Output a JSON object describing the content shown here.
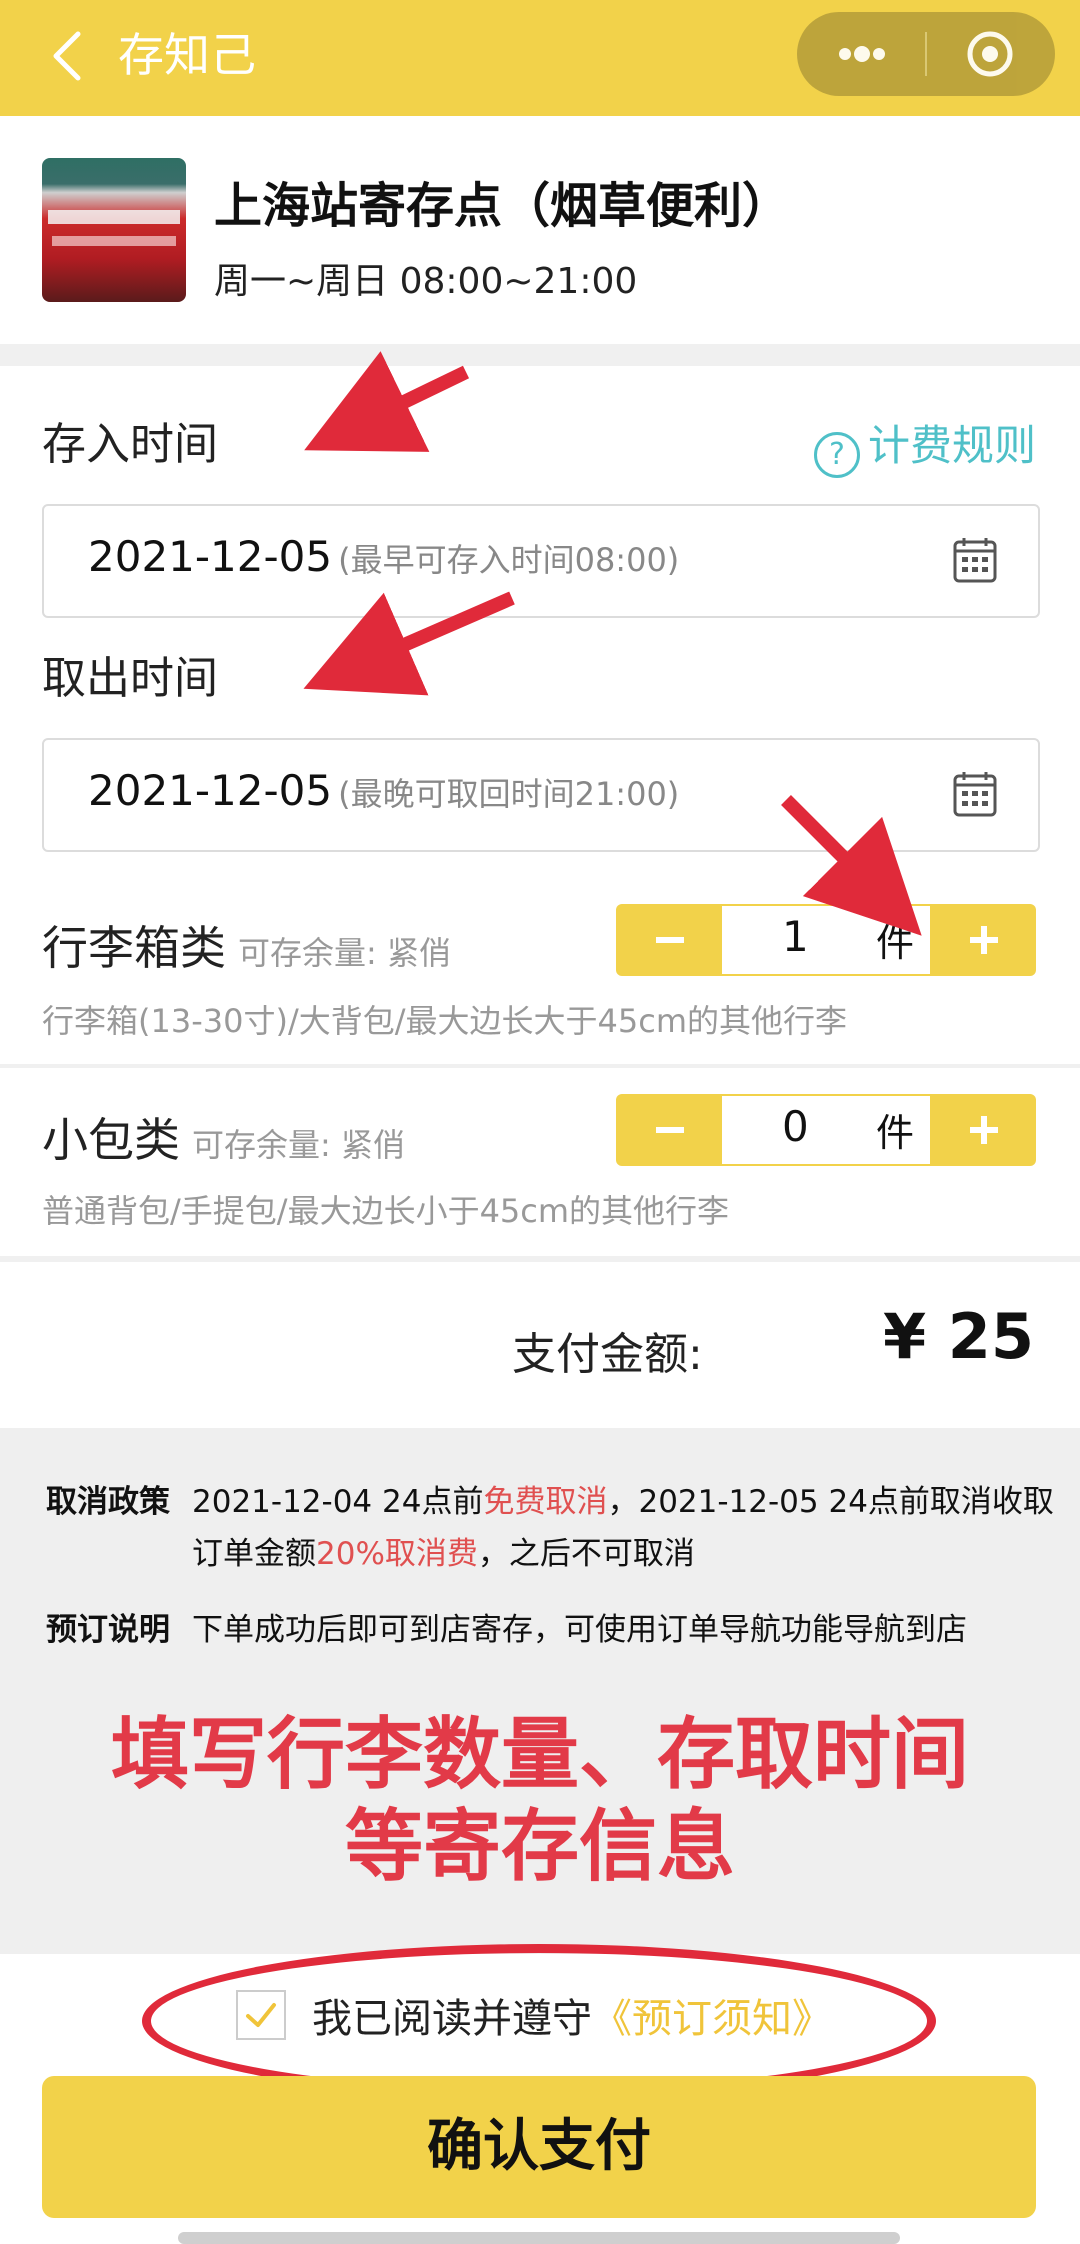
{
  "header": {
    "title": "存知己",
    "back_icon": "chevron-left-icon",
    "more_icon": "more-dots-icon",
    "close_icon": "target-circle-icon"
  },
  "store": {
    "name": "上海站寄存点（烟草便利）",
    "hours": "周一~周日 08:00~21:00"
  },
  "deposit": {
    "label": "存入时间",
    "date": "2021-12-05",
    "hint": "(最早可存入时间08:00)"
  },
  "fee_rules": {
    "label": "计费规则",
    "icon": "question-circle-icon"
  },
  "pickup": {
    "label": "取出时间",
    "date": "2021-12-05",
    "hint": "(最晚可取回时间21:00)"
  },
  "luggage": [
    {
      "title": "行李箱类",
      "stock": "可存余量: 紧俏",
      "desc": "行李箱(13-30寸)/大背包/最大边长大于45cm的其他行李",
      "qty": "1",
      "unit": "件"
    },
    {
      "title": "小包类",
      "stock": "可存余量: 紧俏",
      "desc": "普通背包/手提包/最大边长小于45cm的其他行李",
      "qty": "0",
      "unit": "件"
    }
  ],
  "payment": {
    "label": "支付金额:",
    "amount": "¥ 25"
  },
  "policy": {
    "cancel_key": "取消政策",
    "cancel_1": "2021-12-04 24点前",
    "cancel_free": "免费取消",
    "cancel_2": "，2021-12-05 24点前取消收取订单金额",
    "cancel_fee": "20%取消费",
    "cancel_3": "，之后不可取消",
    "booking_key": "预订说明",
    "booking_text": "下单成功后即可到店寄存，可使用订单导航功能导航到店"
  },
  "overlay": {
    "line1": "填写行李数量、存取时间",
    "line2": "等寄存信息"
  },
  "agreement": {
    "text": "我已阅读并遵守",
    "link": "《预订须知》",
    "checked": true
  },
  "confirm": {
    "label": "确认支付"
  },
  "colors": {
    "accent": "#f2d24a",
    "annotation_red": "#e02a3a",
    "link_teal": "#4fc0c8"
  }
}
